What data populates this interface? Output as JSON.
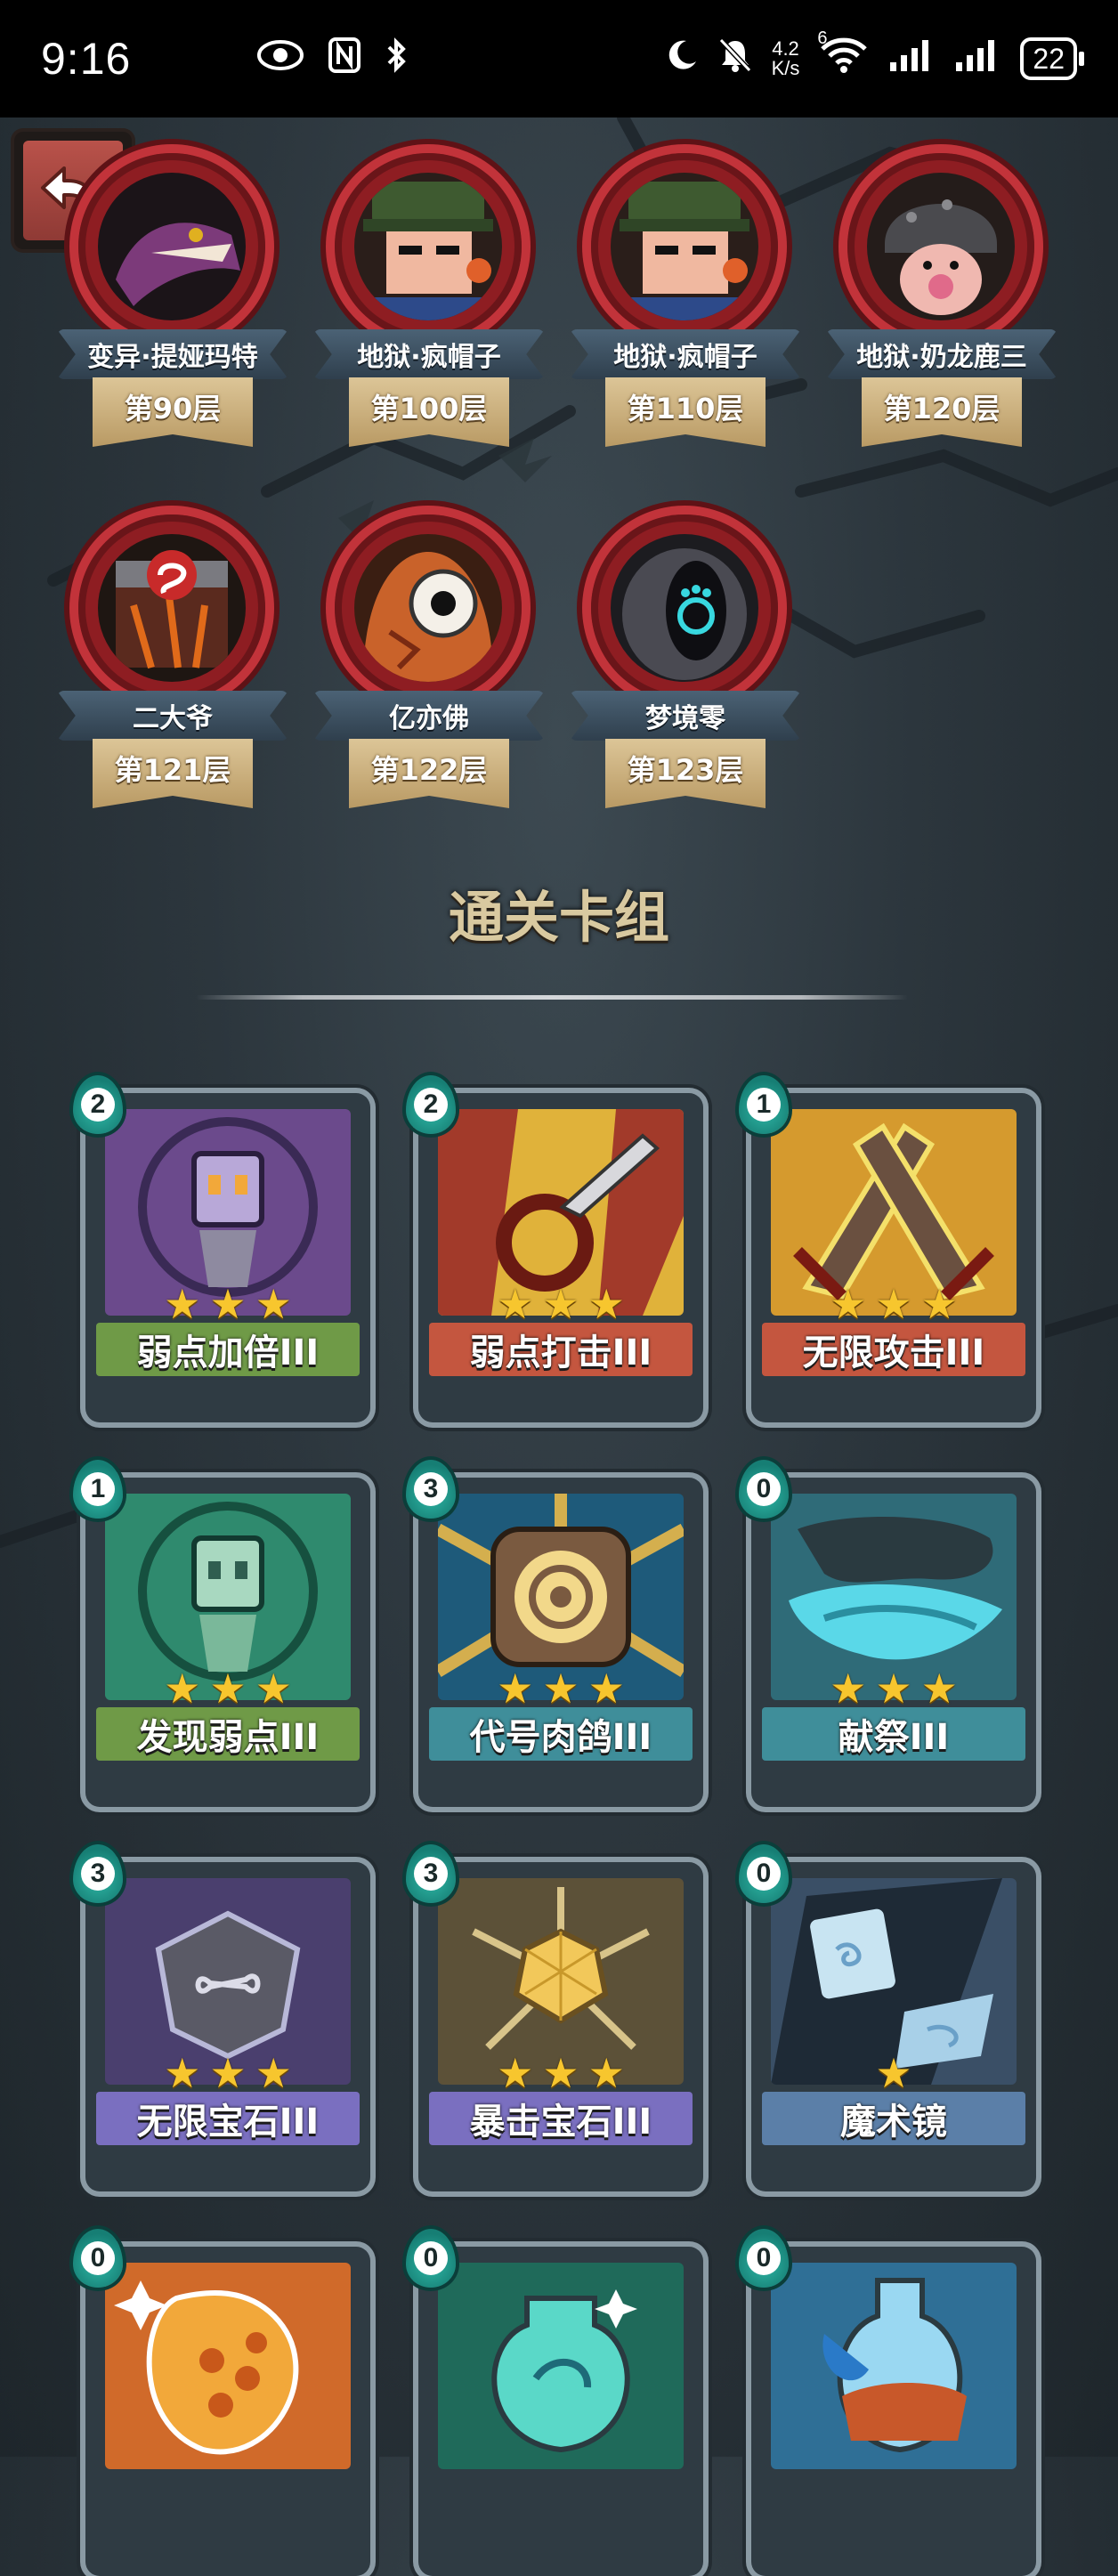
{
  "status_bar": {
    "time": "9:16",
    "net_speed_value": "4.2",
    "net_speed_unit": "K/s",
    "wifi_badge": "6",
    "battery": "22",
    "icons": [
      "eye-icon",
      "nfc-icon",
      "bluetooth-icon",
      "moon-icon",
      "bell-off-icon",
      "wifi-icon",
      "signal-icon",
      "signal-icon",
      "battery-icon"
    ]
  },
  "back_button": {
    "icon": "back-arrow-icon"
  },
  "bosses": [
    {
      "name": "变异·提娅玛特",
      "floor": "第90层"
    },
    {
      "name": "地狱·疯帽子",
      "floor": "第100层"
    },
    {
      "name": "地狱·疯帽子",
      "floor": "第110层"
    },
    {
      "name": "地狱·奶龙鹿三",
      "floor": "第120层"
    },
    {
      "name": "二大爷",
      "floor": "第121层"
    },
    {
      "name": "亿亦佛",
      "floor": "第122层"
    },
    {
      "name": "梦境零",
      "floor": "第123层"
    }
  ],
  "section": {
    "title": "通关卡组"
  },
  "cards": [
    {
      "name": "弱点加倍III",
      "cost": "2",
      "stars": 3,
      "label_color": "#6f9a47",
      "art_color": "#6b4a8c"
    },
    {
      "name": "弱点打击III",
      "cost": "2",
      "stars": 3,
      "label_color": "#c4563f",
      "art_color": "#e0b23a"
    },
    {
      "name": "无限攻击III",
      "cost": "1",
      "stars": 3,
      "label_color": "#c4563f",
      "art_color": "#d59a2e"
    },
    {
      "name": "发现弱点III",
      "cost": "1",
      "stars": 3,
      "label_color": "#6f9a47",
      "art_color": "#2f8a6e"
    },
    {
      "name": "代号肉鸽III",
      "cost": "3",
      "stars": 3,
      "label_color": "#3f8e9a",
      "art_color": "#c79a47"
    },
    {
      "name": "献祭III",
      "cost": "0",
      "stars": 3,
      "label_color": "#3f8e9a",
      "art_color": "#2f6b78"
    },
    {
      "name": "无限宝石III",
      "cost": "3",
      "stars": 3,
      "label_color": "#7a6fc0",
      "art_color": "#4a3f6e"
    },
    {
      "name": "暴击宝石III",
      "cost": "3",
      "stars": 3,
      "label_color": "#7a6fc0",
      "art_color": "#5c5138"
    },
    {
      "name": "魔术镜",
      "cost": "0",
      "stars": 1,
      "label_color": "#5b7fa8",
      "art_color": "#3a4f66"
    },
    {
      "name": "",
      "cost": "0",
      "stars": 0,
      "label_color": "#c4563f",
      "art_color": "#d06a2a"
    },
    {
      "name": "",
      "cost": "0",
      "stars": 0,
      "label_color": "#3f8e9a",
      "art_color": "#1f6a5a"
    },
    {
      "name": "",
      "cost": "0",
      "stars": 0,
      "label_color": "#5b7fa8",
      "art_color": "#2f6f96"
    }
  ]
}
